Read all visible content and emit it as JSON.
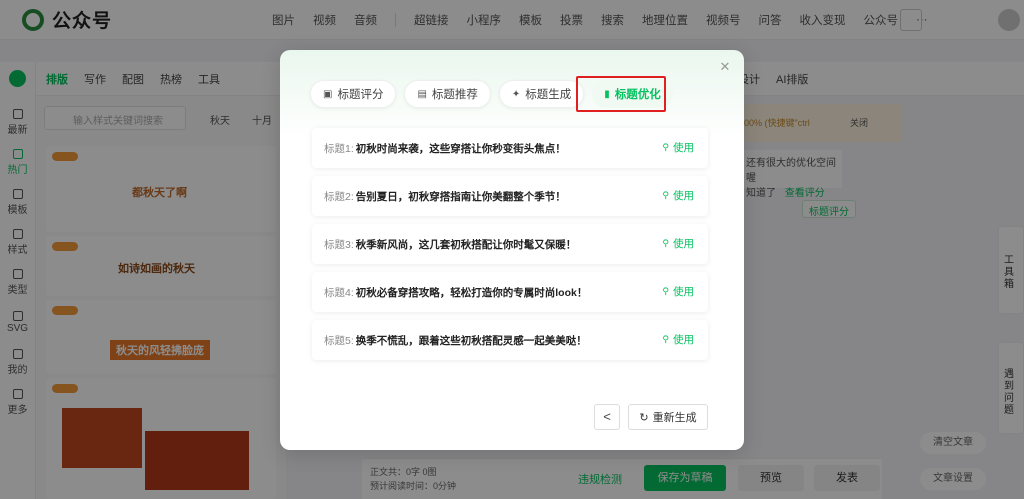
{
  "topbar": {
    "app_name": "公众号",
    "nav": [
      "图片",
      "视频",
      "音频",
      "超链接",
      "小程序",
      "模板",
      "投票",
      "搜索",
      "地理位置",
      "视频号",
      "问答",
      "收入变现",
      "公众号",
      "···"
    ]
  },
  "rail": {
    "items": [
      "最新",
      "热门",
      "模板",
      "样式",
      "类型",
      "SVG",
      "我的",
      "更多"
    ]
  },
  "editor_tabs": [
    "排版",
    "写作",
    "配图",
    "热榜",
    "工具"
  ],
  "panel": {
    "search_placeholder": "输入样式关键词搜索",
    "tags": [
      "秋天",
      "十月"
    ],
    "templates": [
      "都秋天了啊",
      "如诗如画的秋天",
      "秋天的风轻拂脸庞"
    ]
  },
  "right_area": {
    "toolbar": [
      "图片设计",
      "AI排版"
    ],
    "tip_text": "00% (快捷键\"ctrl",
    "tip_close": "关闭",
    "bubble_line1": "还有很大的优化空间喔",
    "bubble_line2": "知道了",
    "bubble_link": "查看评分",
    "score_btn": "标题评分"
  },
  "side_tools": {
    "toolbox": "工具箱",
    "help": "遇到问题"
  },
  "bottom": {
    "word_count": "正文共：0字 0图",
    "read_time": "预计阅读时间：0分钟",
    "check": "违规检测",
    "save": "保存为草稿",
    "preview": "预览",
    "publish": "发表",
    "clear": "清空文章",
    "settings": "文章设置"
  },
  "modal": {
    "tabs": [
      {
        "label": "标题评分",
        "icon": "score-icon"
      },
      {
        "label": "标题推荐",
        "icon": "thumb-icon"
      },
      {
        "label": "标题生成",
        "icon": "sparkle-icon"
      },
      {
        "label": "标题优化",
        "icon": "doc-icon"
      }
    ],
    "active_tab": 3,
    "rows": [
      {
        "label": "标题1:",
        "text": "初秋时尚来袭，这些穿搭让你秒变街头焦点！",
        "action": "使用"
      },
      {
        "label": "标题2:",
        "text": "告别夏日，初秋穿搭指南让你美翻整个季节！",
        "action": "使用"
      },
      {
        "label": "标题3:",
        "text": "秋季新风尚，这几套初秋搭配让你时髦又保暖！",
        "action": "使用"
      },
      {
        "label": "标题4:",
        "text": "初秋必备穿搭攻略，轻松打造你的专属时尚look！",
        "action": "使用"
      },
      {
        "label": "标题5:",
        "text": "换季不慌乱，跟着这些初秋搭配灵感一起美美哒！",
        "action": "使用"
      }
    ],
    "prev": "<",
    "regenerate": "重新生成"
  },
  "colors": {
    "brand": "#07c160",
    "highlight": "#e02020"
  }
}
